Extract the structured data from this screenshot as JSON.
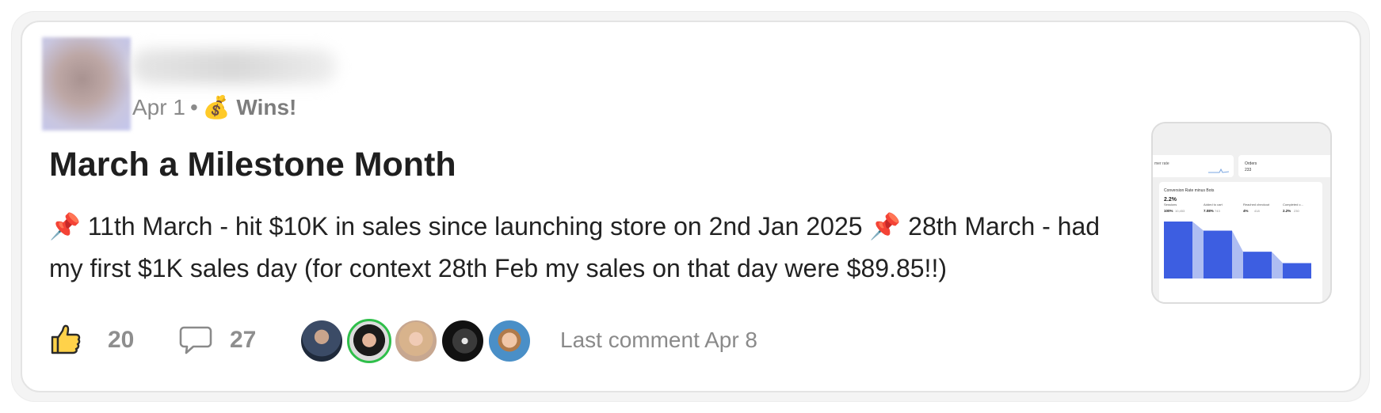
{
  "post": {
    "date": "Apr 1",
    "separator": "•",
    "category_icon": "money-bag-icon",
    "category_emoji": "💰",
    "category": "Wins!",
    "title": "March a Milestone Month",
    "body_pin_icon": "pushpin-icon",
    "body_pin": "📌",
    "body_part1": " 11th March - hit $10K in sales since launching store on 2nd Jan 2025 ",
    "body_part2": " 28th March - had my first $1K sales day (for context 28th Feb my sales on that day were $89.85!!)"
  },
  "thumbnail": {
    "card1_label": "mer rate",
    "card2_label": "Orders",
    "card2_value": "233",
    "panel_title": "Conversion Rate minus Bots",
    "panel_value": "2.2%",
    "steps": [
      {
        "label": "Sessions",
        "pct": "100%",
        "count": "10,453",
        "fraction": 1.0
      },
      {
        "label": "Added to cart",
        "pct": "7.08%",
        "count": "743",
        "fraction": 0.84
      },
      {
        "label": "Reached checkout",
        "pct": "4%",
        "count": "418",
        "fraction": 0.47
      },
      {
        "label": "Completed c...",
        "pct": "2.2%",
        "count": "230",
        "fraction": 0.27
      }
    ],
    "bar_color": "#3d5ee1"
  },
  "footer": {
    "like_icon": "thumbs-up-icon",
    "like_count": "20",
    "comment_icon": "comment-icon",
    "comment_count": "27",
    "last_comment": "Last comment Apr 8"
  },
  "colors": {
    "like_fill": "#ffd24a",
    "muted": "#8a8a8a",
    "title": "#1f1f1f"
  }
}
